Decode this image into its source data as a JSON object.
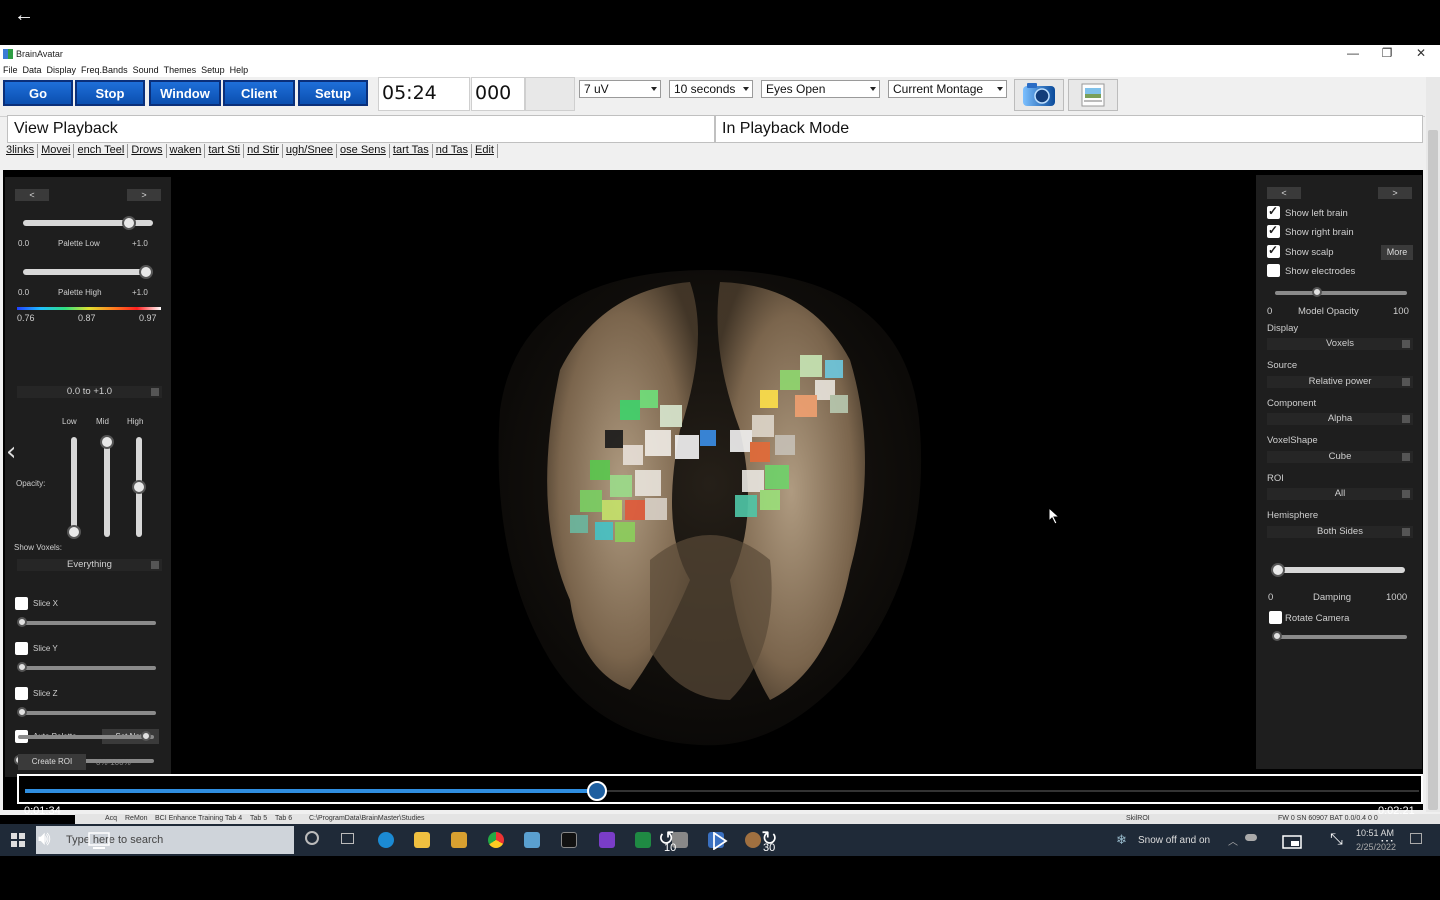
{
  "player": {
    "back_icon": "←"
  },
  "window": {
    "title": "BrainAvatar",
    "controls": {
      "minimize": "—",
      "maximize": "❐",
      "close": "✕"
    }
  },
  "menu": [
    "File",
    "Data",
    "Display",
    "Freq.Bands",
    "Sound",
    "Themes",
    "Setup",
    "Help"
  ],
  "toolbar": {
    "go": "Go",
    "stop": "Stop",
    "window": "Window",
    "client": "Client",
    "setup": "Setup",
    "time_readout": "05:24",
    "count_readout": "000",
    "scale_select": "7 uV",
    "duration_select": "10 seconds",
    "condition_select": "Eyes Open",
    "montage_select": "Current Montage"
  },
  "info": {
    "left": "View Playback",
    "right": "In Playback Mode"
  },
  "events": [
    "3links",
    "Movei",
    "ench Teel",
    "Drows",
    "waken",
    "tart Sti",
    "nd Stir",
    "ugh/Snee",
    "ose Sens",
    "tart Tas",
    "nd Tas",
    "Edit"
  ],
  "left_panel": {
    "prev": "<",
    "next": ">",
    "palette_low": {
      "min": "0.0",
      "label": "Palette Low",
      "max": "+1.0",
      "value": 0.85
    },
    "palette_high": {
      "min": "0.0",
      "label": "Palette High",
      "max": "+1.0",
      "value": 1.0
    },
    "colorbar_ticks": [
      "0.76",
      "0.87",
      "0.97"
    ],
    "range_select": "0.0 to +1.0",
    "opacity_headers": [
      "Low",
      "Mid",
      "High"
    ],
    "opacity_label": "Opacity:",
    "opacity_values": {
      "low": 0.0,
      "mid": 1.0,
      "high": 0.5
    },
    "show_voxels_label": "Show Voxels:",
    "show_voxels_select": "Everything",
    "slice_x": "Slice X",
    "slice_y": "Slice Y",
    "slice_z": "Slice Z",
    "auto_palette": "Auto Palette",
    "set_now": "Set Now",
    "create_roi": "Create ROI",
    "roi_range": "0%-100%"
  },
  "right_panel": {
    "prev": "<",
    "next": ">",
    "show_left_brain": "Show left brain",
    "show_right_brain": "Show right brain",
    "show_scalp": "Show scalp",
    "more": "More",
    "show_electrodes": "Show electrodes",
    "model_opacity": {
      "min": "0",
      "label": "Model Opacity",
      "max": "100",
      "value": 0.3
    },
    "display_label": "Display",
    "display_select": "Voxels",
    "source_label": "Source",
    "source_select": "Relative power",
    "component_label": "Component",
    "component_select": "Alpha",
    "voxelshape_label": "VoxelShape",
    "voxelshape_select": "Cube",
    "roi_label": "ROI",
    "roi_select": "All",
    "hemisphere_label": "Hemisphere",
    "hemisphere_select": "Both Sides",
    "damping": {
      "min": "0",
      "label": "Damping",
      "max": "1000",
      "value": 0.0
    },
    "rotate_camera": "Rotate Camera"
  },
  "playback": {
    "elapsed": "0:01:34",
    "total": "0:02:21",
    "progress": 0.41
  },
  "statusbar": {
    "tabs": [
      "Acq",
      "ReMon",
      "BCI Enhance Training",
      "Tab 4",
      "Tab 5",
      "Tab 6"
    ],
    "path": "C:\\ProgramData\\BrainMaster\\Studies",
    "center": "SkilROI",
    "right": "FW 0 SN 60907 BAT 0.0/0.4   0   0"
  },
  "taskbar": {
    "search_placeholder": "Type here to search",
    "weather": "Snow off and on",
    "clock_time": "10:51 AM",
    "clock_date": "2/25/2022",
    "rewind_label": "10",
    "forward_label": "30"
  }
}
